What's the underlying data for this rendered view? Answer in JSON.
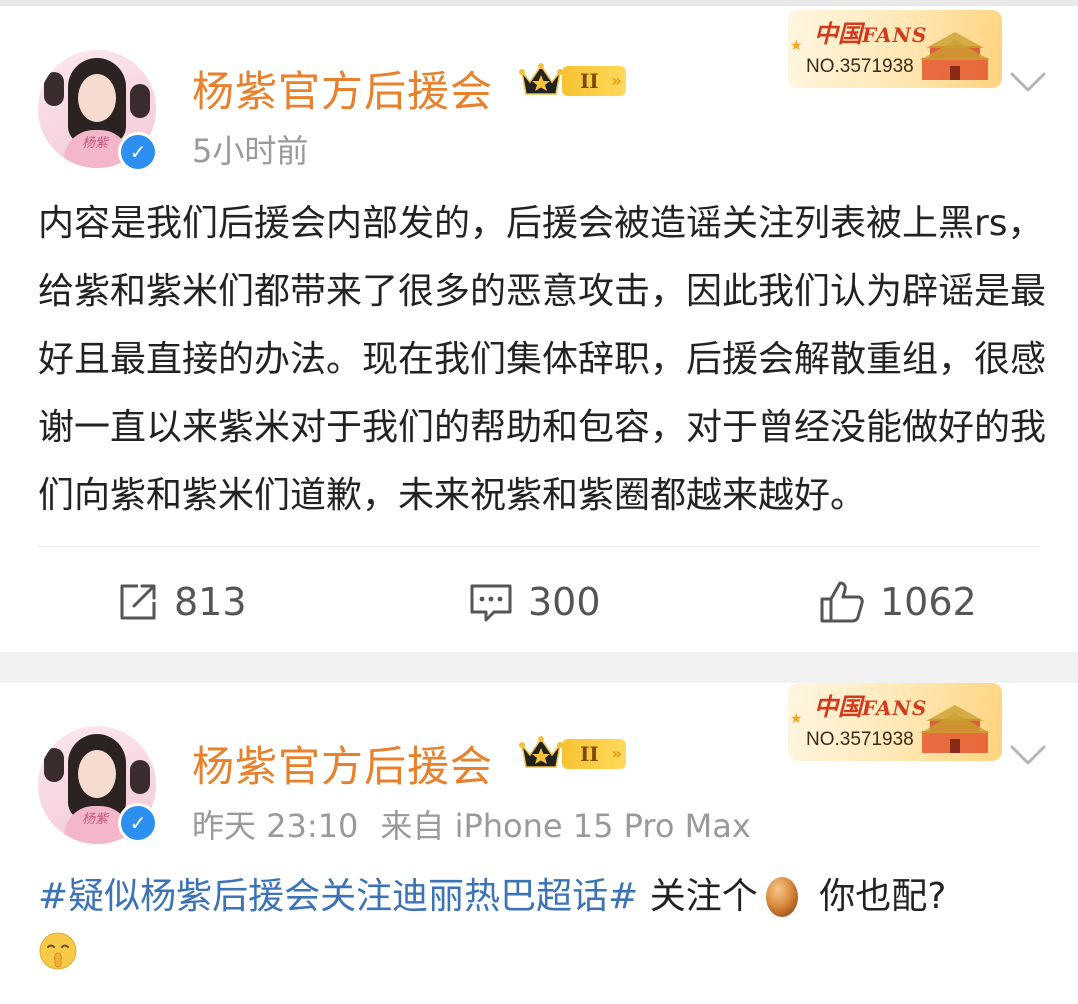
{
  "posts": [
    {
      "author": "杨紫官方后援会",
      "level": "II",
      "fans_badge": {
        "title_cn": "中国",
        "title_en": "FANS",
        "number": "NO.3571938"
      },
      "time": "5小时前",
      "source": "",
      "text": "内容是我们后援会内部发的，后援会被造谣关注列表被上黑rs，给紫和紫米们都带来了很多的恶意攻击，因此我们认为辟谣是最好且最直接的办法。现在我们集体辞职，后援会解散重组，很感谢一直以来紫米对于我们的帮助和包容，对于曾经没能做好的我们向紫和紫米们道歉，未来祝紫和紫圈都越来越好。",
      "actions": {
        "reposts": "813",
        "comments": "300",
        "likes": "1062"
      }
    },
    {
      "author": "杨紫官方后援会",
      "level": "II",
      "fans_badge": {
        "title_cn": "中国",
        "title_en": "FANS",
        "number": "NO.3571938"
      },
      "time": "昨天 23:10",
      "source": "来自 iPhone 15 Pro Max",
      "hashtag": "#疑似杨紫后援会关注迪丽热巴超话#",
      "text_before_emoji": " 关注个",
      "text_after_emoji": " 你也配?"
    }
  ],
  "avatar_script": "杨紫",
  "icons": {
    "verified": "verified-badge-icon",
    "crown": "crown-icon",
    "repost": "repost-icon",
    "comment": "comment-icon",
    "like": "like-icon",
    "chevron": "chevron-down-icon",
    "egg": "egg-emoji-icon",
    "face": "shushing-face-emoji-icon"
  },
  "colors": {
    "author_name": "#e8802c",
    "hashtag": "#3b73b6",
    "meta_text": "#9a9a9a",
    "verified": "#2d8ff0"
  }
}
